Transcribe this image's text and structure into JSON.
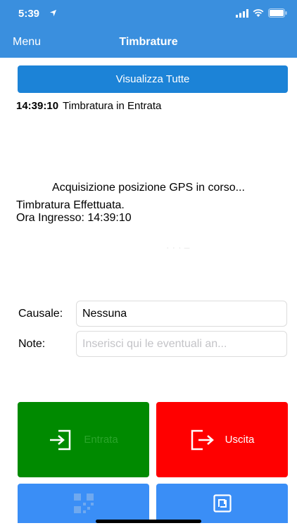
{
  "status_bar": {
    "time": "5:39"
  },
  "nav": {
    "menu_label": "Menu",
    "title": "Timbrature"
  },
  "actions": {
    "view_all_label": "Visualizza Tutte"
  },
  "last_punch": {
    "time": "14:39:10",
    "type": "Timbratura in Entrata"
  },
  "messages": {
    "gps": "Acquisizione posizione GPS in corso...",
    "done": "Timbratura Effettuata.",
    "check_in": "Ora Ingresso: 14:39:10"
  },
  "form": {
    "causale_label": "Causale:",
    "causale_value": "Nessuna",
    "note_label": "Note:",
    "note_placeholder": "Inserisci qui le eventuali an..."
  },
  "buttons": {
    "entrata_label": "Entrata",
    "uscita_label": "Uscita"
  },
  "colors": {
    "header": "#3a8fde",
    "primary_button": "#1c83d7",
    "entrata": "#008a00",
    "uscita": "#ff0000",
    "secondary_button": "#3a8ef6"
  }
}
